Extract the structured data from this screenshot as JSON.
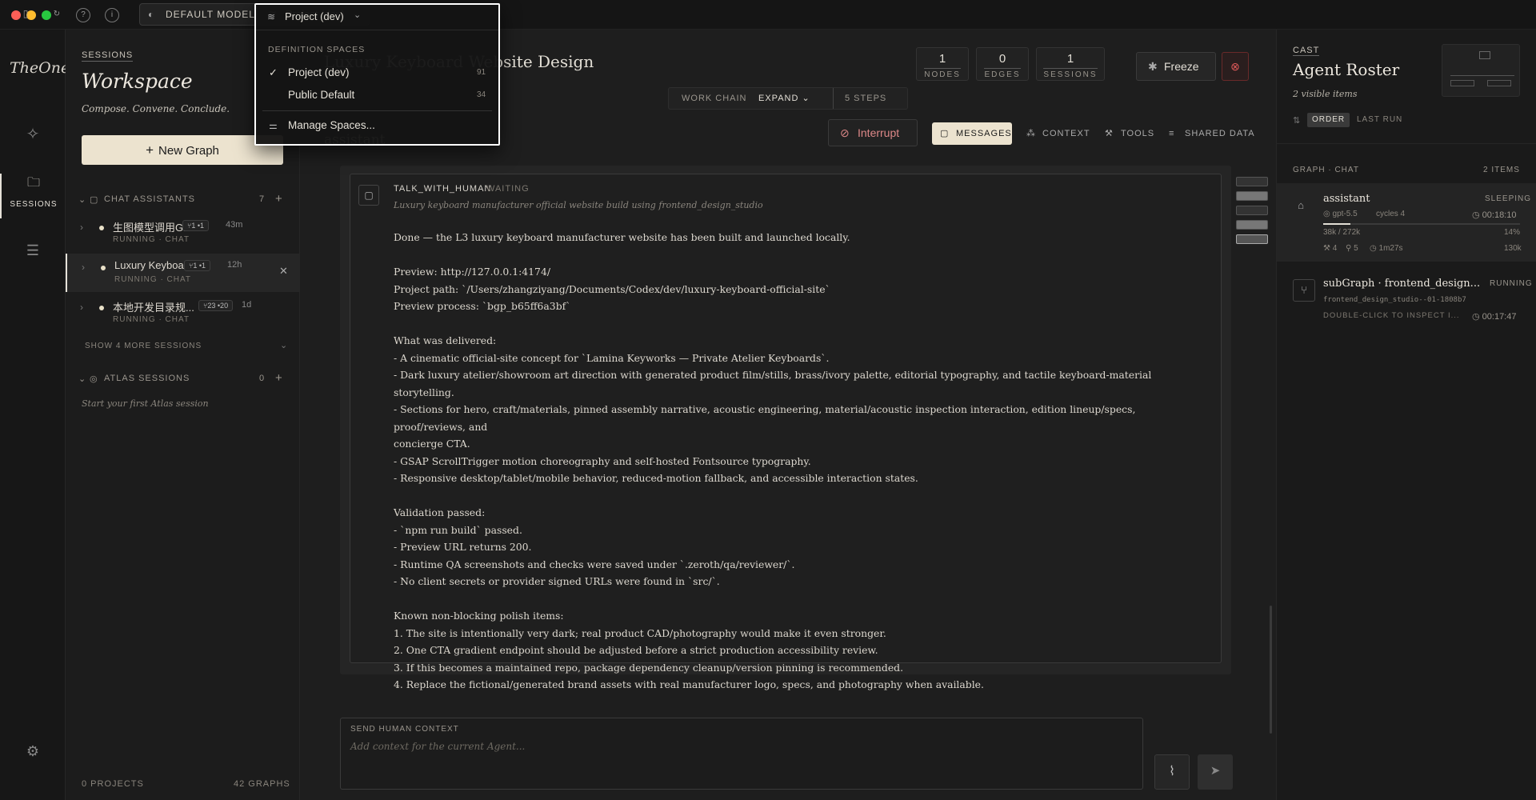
{
  "titlebar": {
    "model_label": "DEFAULT MODEL",
    "project_label": "Project (dev)",
    "traffic_colors": [
      "#ff5f57",
      "#febc2e",
      "#28c840"
    ]
  },
  "rail": {
    "logo": "TheOne",
    "sessions_label": "SESSIONS"
  },
  "sessions": {
    "eyebrow": "SESSIONS",
    "title": "Workspace",
    "tagline": "Compose. Convene. Conclude.",
    "new_graph": "New Graph",
    "chat_group": {
      "label": "CHAT ASSISTANTS",
      "count": "7"
    },
    "items": [
      {
        "title": "生图模型调用Gr...",
        "badge": "⑂1 •1",
        "age": "43m",
        "status": "RUNNING · CHAT"
      },
      {
        "title": "Luxury Keyboar...",
        "badge": "⑂1 •1",
        "age": "12h",
        "status": "RUNNING · CHAT"
      },
      {
        "title": "本地开发目录规...",
        "badge": "⑂23 •20",
        "age": "1d",
        "status": "RUNNING · CHAT"
      }
    ],
    "show_more": "SHOW 4 MORE SESSIONS",
    "atlas_group": {
      "label": "ATLAS SESSIONS",
      "count": "0"
    },
    "atlas_empty": "Start your first Atlas session",
    "footer_projects": "0 PROJECTS",
    "footer_graphs": "42 GRAPHS"
  },
  "main": {
    "page_title": "Luxury Keyboard Website Design",
    "stats": [
      {
        "n": "1",
        "l": "NODES"
      },
      {
        "n": "0",
        "l": "EDGES"
      },
      {
        "n": "1",
        "l": "SESSIONS"
      }
    ],
    "freeze": "Freeze",
    "work_chain": "WORK CHAIN",
    "expand": "EXPAND",
    "steps": "5 STEPS",
    "agent_name": "assistant",
    "interrupt": "Interrupt",
    "tabs": [
      "MESSAGES",
      "CONTEXT",
      "TOOLS",
      "SHARED DATA"
    ],
    "message": {
      "kind": "TALK_WITH_HUMAN",
      "state": "WAITING",
      "subtitle": "Luxury keyboard manufacturer official website build using frontend_design_studio",
      "body": "Done — the L3 luxury keyboard manufacturer website has been built and launched locally.\n\nPreview: http://127.0.0.1:4174/\nProject path: `/Users/zhangziyang/Documents/Codex/dev/luxury-keyboard-official-site`\nPreview process: `bgp_b65ff6a3bf`\n\nWhat was delivered:\n- A cinematic official-site concept for `Lamina Keyworks — Private Atelier Keyboards`.\n- Dark luxury atelier/showroom art direction with generated product film/stills, brass/ivory palette, editorial typography, and tactile keyboard-material storytelling.\n- Sections for hero, craft/materials, pinned assembly narrative, acoustic engineering, material/acoustic inspection interaction, edition lineup/specs, proof/reviews, and\nconcierge CTA.\n- GSAP ScrollTrigger motion choreography and self-hosted Fontsource typography.\n- Responsive desktop/tablet/mobile behavior, reduced-motion fallback, and accessible interaction states.\n\nValidation passed:\n- `npm run build` passed.\n- Preview URL returns 200.\n- Runtime QA screenshots and checks were saved under `.zeroth/qa/reviewer/`.\n- No client secrets or provider signed URLs were found in `src/`.\n\nKnown non-blocking polish items:\n1. The site is intentionally very dark; real product CAD/photography would make it even stronger.\n2. One CTA gradient endpoint should be adjusted before a strict production accessibility review.\n3. If this becomes a maintained repo, package dependency cleanup/version pinning is recommended.\n4. Replace the fictional/generated brand assets with real manufacturer logo, specs, and photography when available."
    },
    "composer": {
      "label": "SEND HUMAN CONTEXT",
      "placeholder": "Add context for the current Agent..."
    }
  },
  "cast": {
    "eyebrow": "CAST",
    "title": "Agent Roster",
    "subtitle": "2 visible items",
    "order": "ORDER",
    "last_run": "LAST RUN",
    "section": "GRAPH · CHAT",
    "count": "2 ITEMS",
    "agents": [
      {
        "name": "assistant",
        "status": "SLEEPING",
        "model": "gpt-5.5",
        "cycles": "cycles 4",
        "time": "00:18:10",
        "tokens": "38k / 272k",
        "pct": "14%",
        "progress": 0.14,
        "tools": "4",
        "calls": "5",
        "dur": "1m27s",
        "ctx": "130k"
      },
      {
        "name": "subGraph · frontend_design...",
        "status": "RUNNING",
        "id": "frontend_design_studio--01-1808b7",
        "hint": "DOUBLE-CLICK TO INSPECT I...",
        "time": "00:17:47"
      }
    ]
  },
  "dropdown": {
    "heading": "DEFINITION SPACES",
    "items": [
      {
        "label": "Project (dev)",
        "count": "91",
        "checked": true
      },
      {
        "label": "Public Default",
        "count": "34",
        "checked": false
      }
    ],
    "manage": "Manage Spaces..."
  },
  "icons": [
    "gear-icon",
    "help-icon",
    "info-icon",
    "model-icon",
    "layers-icon",
    "chevron-down-icon",
    "sparkle-icon",
    "folder-icon",
    "sliders-icon",
    "plus-icon",
    "chat-icon",
    "atlas-icon",
    "close-icon",
    "snowflake-icon",
    "stop-icon",
    "ban-icon",
    "message-icon",
    "context-icon",
    "wrench-icon",
    "database-icon",
    "paperclip-icon",
    "send-icon",
    "robot-icon",
    "branch-icon",
    "check-icon",
    "sort-icon",
    "clock-icon"
  ]
}
